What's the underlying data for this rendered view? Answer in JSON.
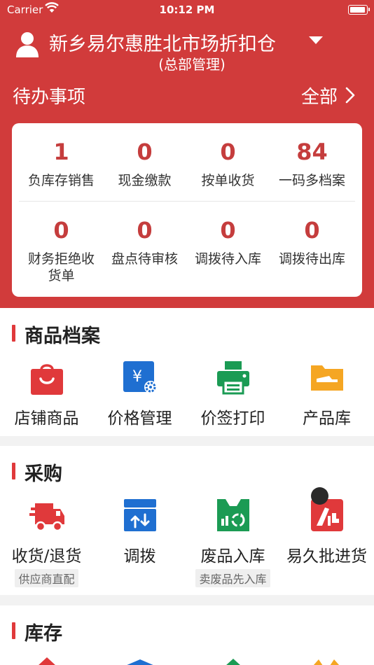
{
  "status_bar": {
    "carrier": "Carrier",
    "time": "10:12 PM"
  },
  "header": {
    "store_name": "新乡易尔惠胜北市场折扣仓",
    "store_subtitle": "(总部管理)"
  },
  "todo": {
    "title": "待办事项",
    "all_label": "全部",
    "items": [
      {
        "count": "1",
        "label": "负库存销售"
      },
      {
        "count": "0",
        "label": "现金缴款"
      },
      {
        "count": "0",
        "label": "按单收货"
      },
      {
        "count": "84",
        "label": "一码多档案"
      },
      {
        "count": "0",
        "label": "财务拒绝收货单"
      },
      {
        "count": "0",
        "label": "盘点待审核"
      },
      {
        "count": "0",
        "label": "调拨待入库"
      },
      {
        "count": "0",
        "label": "调拨待出库"
      }
    ]
  },
  "sections": {
    "products": {
      "title": "商品档案",
      "items": [
        {
          "label": "店铺商品",
          "icon": "shopping-bag-icon"
        },
        {
          "label": "价格管理",
          "icon": "price-settings-icon"
        },
        {
          "label": "价签打印",
          "icon": "printer-icon"
        },
        {
          "label": "产品库",
          "icon": "folder-icon"
        }
      ]
    },
    "purchase": {
      "title": "采购",
      "items": [
        {
          "label": "收货/退货",
          "tag": "供应商直配",
          "icon": "delivery-truck-icon"
        },
        {
          "label": "调拨",
          "icon": "transfer-box-icon"
        },
        {
          "label": "废品入库",
          "tag": "卖废品先入库",
          "icon": "recycle-icon"
        },
        {
          "label": "易久批进货",
          "icon": "yijiupi-icon"
        }
      ]
    },
    "inventory": {
      "title": "库存"
    }
  },
  "colors": {
    "brand_red": "#d13b3b",
    "count_red": "#c53d3d",
    "icon_red": "#e0393b",
    "icon_blue": "#1f6fd1",
    "icon_green": "#1b9b54",
    "icon_orange": "#f5a623"
  }
}
